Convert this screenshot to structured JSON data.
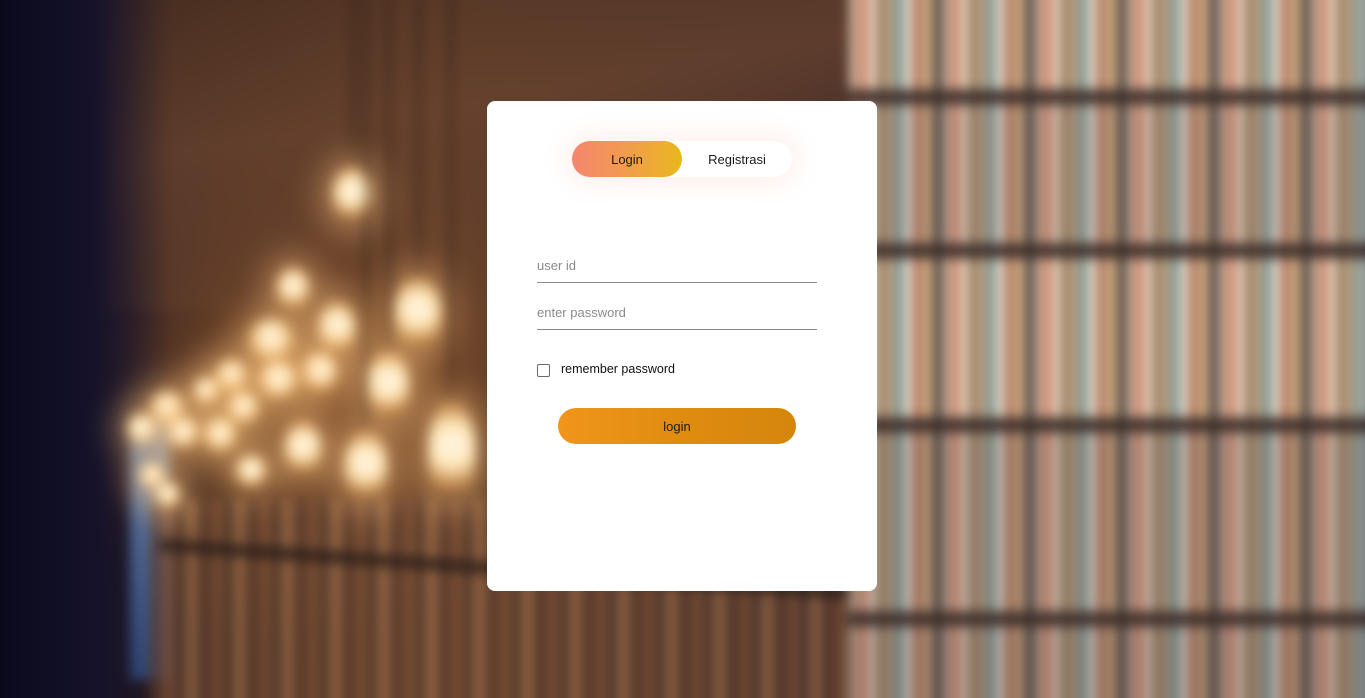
{
  "tabs": {
    "login_label": "Login",
    "register_label": "Registrasi",
    "active": "Login"
  },
  "form": {
    "user_placeholder": "user id",
    "user_value": "",
    "password_placeholder": "enter password",
    "password_value": "",
    "remember_label": "remember password",
    "remember_checked": false,
    "submit_label": "login"
  },
  "colors": {
    "tab_gradient_start": "#f5866e",
    "tab_gradient_end": "#e9b81c",
    "button_color": "#e08c10",
    "card_background": "#ffffff"
  }
}
